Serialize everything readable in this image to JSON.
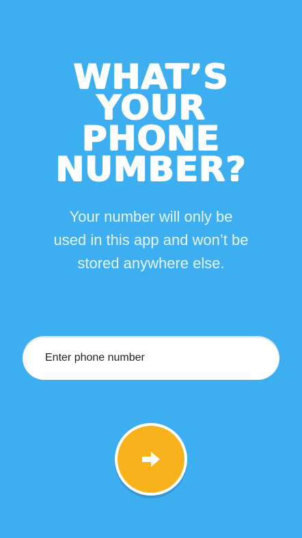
{
  "title_lines": [
    "WHAT’S",
    "YOUR",
    "PHONE",
    "NUMBER?"
  ],
  "subtitle_lines": [
    "Your number will only be",
    "used in this app and won’t be",
    "stored anywhere else."
  ],
  "phone_input": {
    "placeholder": "Enter phone number",
    "value": ""
  },
  "submit_button": {
    "icon": "arrow-right-icon"
  },
  "colors": {
    "background": "#3daef0",
    "accent": "#f8b31c",
    "text": "#ffffff"
  }
}
